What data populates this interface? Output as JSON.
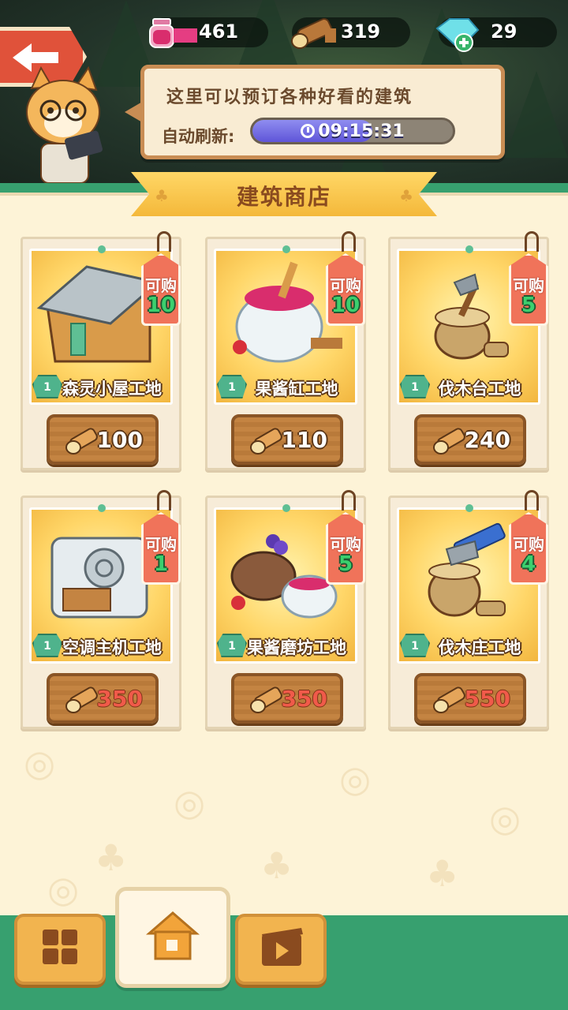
{
  "resources": {
    "jam": "461",
    "wood": "319",
    "gems": "29"
  },
  "bubble": {
    "message": "这里可以预订各种好看的建筑",
    "refresh_label": "自动刷新:",
    "timer": "09:15:31",
    "timer_progress": 0.6
  },
  "shop": {
    "title": "建筑商店",
    "buy_label": "可购",
    "items": [
      {
        "name": "森灵小屋工地",
        "level": "1",
        "stock": "10",
        "price": "100",
        "affordable": true
      },
      {
        "name": "果酱缸工地",
        "level": "1",
        "stock": "10",
        "price": "110",
        "affordable": true
      },
      {
        "name": "伐木台工地",
        "level": "1",
        "stock": "5",
        "price": "240",
        "affordable": true
      },
      {
        "name": "空调主机工地",
        "level": "1",
        "stock": "1",
        "price": "350",
        "affordable": false
      },
      {
        "name": "果酱磨坊工地",
        "level": "1",
        "stock": "5",
        "price": "350",
        "affordable": false
      },
      {
        "name": "伐木庄工地",
        "level": "1",
        "stock": "4",
        "price": "550",
        "affordable": false
      }
    ]
  },
  "nav": {
    "items": [
      "grid-icon",
      "home-icon",
      "video-icon"
    ],
    "active": "home-icon"
  },
  "colors": {
    "green": "#37a06f",
    "orange_btn": "#f2b44f",
    "price_unaffordable": "#f05a4a",
    "stock_green": "#3bd06e"
  }
}
